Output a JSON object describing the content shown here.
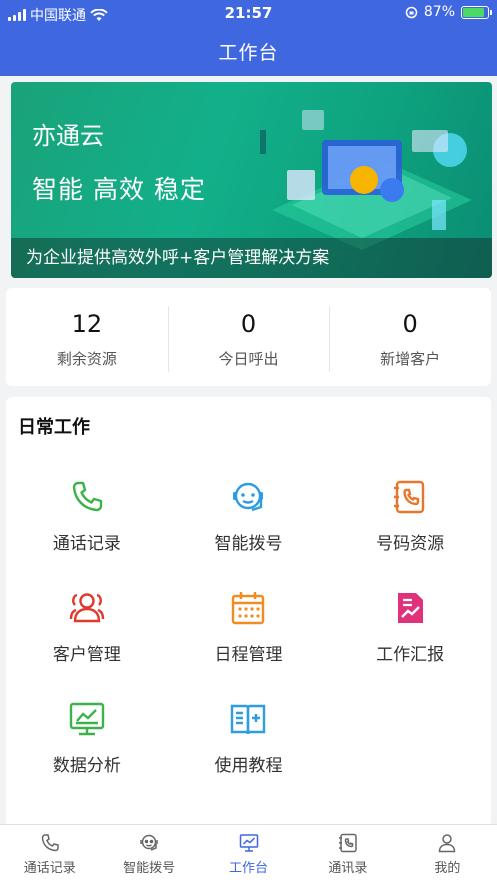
{
  "status_bar": {
    "carrier": "中国联通",
    "time": "21:57",
    "battery": "87%",
    "battery_level": 0.87
  },
  "header": {
    "title": "工作台"
  },
  "banner": {
    "brand": "亦通云",
    "slogan": "智能 高效 稳定",
    "caption": "为企业提供高效外呼+客户管理解决方案"
  },
  "stats": [
    {
      "value": "12",
      "label": "剩余资源"
    },
    {
      "value": "0",
      "label": "今日呼出"
    },
    {
      "value": "0",
      "label": "新增客户"
    }
  ],
  "work": {
    "title": "日常工作",
    "items": [
      {
        "label": "通话记录",
        "icon": "phone-icon",
        "color": "#3bb34a"
      },
      {
        "label": "智能拨号",
        "icon": "headset-robot-icon",
        "color": "#2d9de0"
      },
      {
        "label": "号码资源",
        "icon": "phone-list-icon",
        "color": "#e8762d"
      },
      {
        "label": "客户管理",
        "icon": "users-icon",
        "color": "#e0392e"
      },
      {
        "label": "日程管理",
        "icon": "calendar-icon",
        "color": "#f08c22"
      },
      {
        "label": "工作汇报",
        "icon": "report-chart-icon",
        "color": "#e0327a"
      },
      {
        "label": "数据分析",
        "icon": "monitor-chart-icon",
        "color": "#3bb34a"
      },
      {
        "label": "使用教程",
        "icon": "book-icon",
        "color": "#2d9de0"
      }
    ]
  },
  "tabbar": {
    "items": [
      {
        "label": "通话记录",
        "icon": "phone-icon"
      },
      {
        "label": "智能拨号",
        "icon": "headset-robot-icon"
      },
      {
        "label": "工作台",
        "icon": "monitor-icon",
        "active": true
      },
      {
        "label": "通讯录",
        "icon": "contacts-icon"
      },
      {
        "label": "我的",
        "icon": "user-icon"
      }
    ],
    "active_color": "#3f67e0"
  },
  "colors": {
    "primary": "#3f67e0",
    "banner_green": "#12b08a"
  }
}
